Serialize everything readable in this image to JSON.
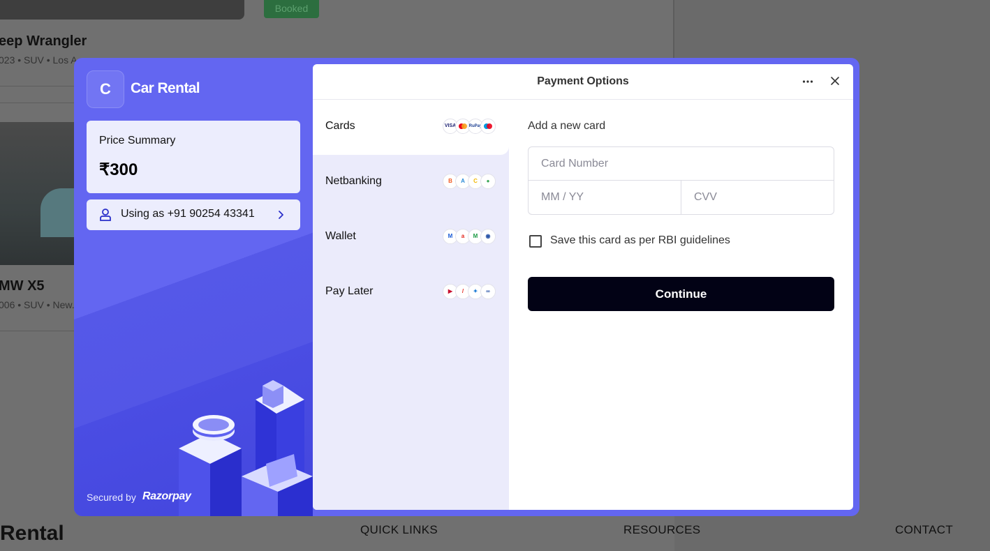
{
  "background": {
    "booked_badge": "Booked",
    "cards": [
      {
        "title": "eep Wrangler",
        "subtitle": "023 • SUV • Los A..."
      },
      {
        "title": "MW X5",
        "subtitle": "006 • SUV • New..."
      }
    ],
    "footer": {
      "brand": "Rental",
      "links": [
        "QUICK LINKS",
        "RESOURCES",
        "CONTACT"
      ]
    }
  },
  "modal": {
    "brand": {
      "logo_letter": "C",
      "name": "Car Rental"
    },
    "price_summary": {
      "label": "Price Summary",
      "amount": "₹300"
    },
    "user": {
      "label": "Using as +91 90254 43341"
    },
    "footer": {
      "secured_by": "Secured by",
      "provider": "Razorpay"
    },
    "colors": {
      "accent": "#6366f1",
      "primary_button": "#020215"
    }
  },
  "payment": {
    "title": "Payment Options",
    "methods": [
      {
        "label": "Cards",
        "icons": [
          "visa-logo",
          "mastercard-logo",
          "rupay-logo",
          "maestro-logo"
        ]
      },
      {
        "label": "Netbanking",
        "icons": [
          "bank-of-baroda-logo",
          "axis-bank-logo",
          "canara-bank-logo",
          "sbi-logo"
        ]
      },
      {
        "label": "Wallet",
        "icons": [
          "mobikwik-logo",
          "airtel-logo",
          "myjio-logo",
          "wallet-logo"
        ]
      },
      {
        "label": "Pay Later",
        "icons": [
          "paylater-logo-1",
          "paylater-logo-2",
          "paylater-logo-3",
          "paylater-logo-4"
        ]
      }
    ],
    "selected_method": "Cards",
    "form": {
      "heading": "Add a new card",
      "card_number_placeholder": "Card Number",
      "expiry_placeholder": "MM / YY",
      "cvv_placeholder": "CVV",
      "save_label": "Save this card as per RBI guidelines",
      "save_checked": false,
      "continue_label": "Continue"
    }
  }
}
